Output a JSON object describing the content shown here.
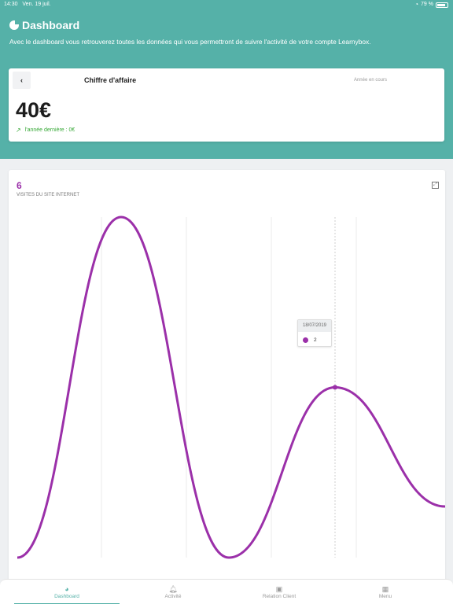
{
  "status_bar": {
    "time": "14:30",
    "date": "Ven. 19 juil.",
    "battery": "79 %"
  },
  "header": {
    "title": "Dashboard",
    "description": "Avec le dashboard vous retrouverez toutes les données qui vous permettront de suivre l'activité de votre compte Learnybox."
  },
  "revenue_card": {
    "title": "Chiffre d'affaire",
    "period": "Année en cours",
    "amount": "40€",
    "comparison": "l'année dernière : 0€"
  },
  "visits_card": {
    "count": "6",
    "label": "VISITES DU SITE INTERNET",
    "tooltip": {
      "date": "18/07/2019",
      "value": "2"
    }
  },
  "chart_data": {
    "type": "line",
    "series": [
      {
        "color": "#9b30a9",
        "values": [
          0,
          4,
          0,
          2,
          0.6
        ]
      }
    ],
    "highlight": {
      "date": "18/07/2019",
      "value": 2
    }
  },
  "nav": {
    "items": [
      {
        "label": "Dashboard",
        "icon": "pie-chart-icon",
        "active": true
      },
      {
        "label": "Activité",
        "icon": "bell-icon",
        "active": false
      },
      {
        "label": "Relation Client",
        "icon": "contact-card-icon",
        "active": false
      },
      {
        "label": "Menu",
        "icon": "grid-icon",
        "active": false
      }
    ]
  },
  "colors": {
    "accent": "#55b1a8",
    "series": "#9b30a9",
    "positive": "#36a836"
  }
}
